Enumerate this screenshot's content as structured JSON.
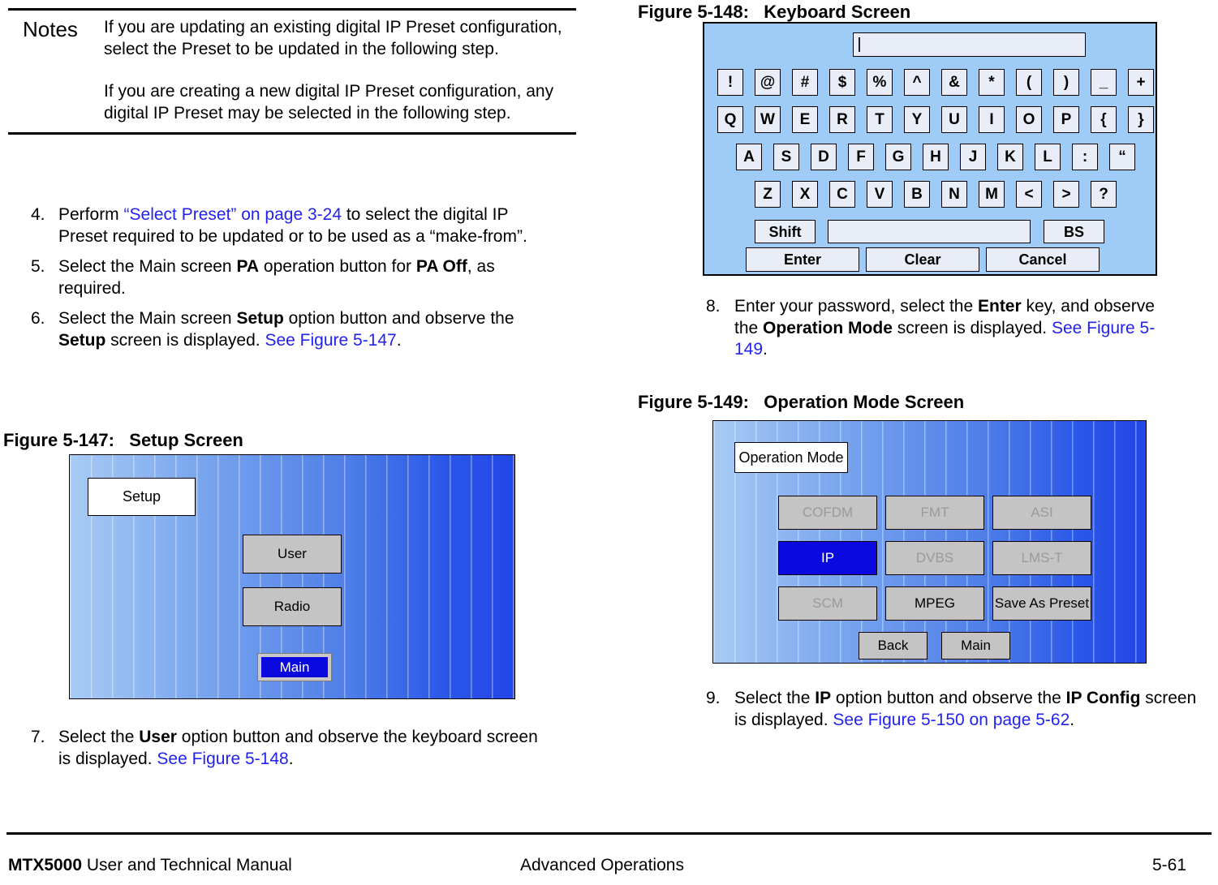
{
  "notes": {
    "label": "Notes",
    "paragraph1": "If you are updating an existing digital IP Preset configuration, select the Preset to be updated in the following step.",
    "paragraph2": "If you are creating a new digital IP Preset configuration, any digital IP Preset may be selected in the following step."
  },
  "steps": {
    "s4": {
      "num": "4.",
      "t1": "Perform ",
      "link1": "“Select Preset” on page 3-24",
      "t2": " to select the digital IP Preset required to be updated or to be used as a “make-from”."
    },
    "s5": {
      "num": "5.",
      "t1": "Select the Main screen ",
      "b1": "PA",
      "t2": " operation button for ",
      "b2": "PA Off",
      "t3": ", as required."
    },
    "s6": {
      "num": "6.",
      "t1": "Select the Main screen ",
      "b1": "Setup",
      "t2": " option button and observe the ",
      "b2": "Setup",
      "t3": " screen is displayed.  ",
      "link1": "See Figure 5-147",
      "t4": "."
    },
    "s7": {
      "num": "7.",
      "t1": "Select the ",
      "b1": "User",
      "t2": " option button and observe the keyboard screen is displayed.  ",
      "link1": "See Figure 5-148",
      "t3": "."
    },
    "s8": {
      "num": "8.",
      "t1": "Enter your password, select the ",
      "b1": "Enter",
      "t2": " key, and observe the ",
      "b2": "Operation Mode",
      "t3": " screen is displayed. ",
      "link1": "See Figure 5-149",
      "t4": "."
    },
    "s9": {
      "num": "9.",
      "t1": "Select the ",
      "b1": "IP",
      "t2": " option button and observe the ",
      "b2": "IP Config",
      "t3": " screen is displayed.  ",
      "link1": "See Figure 5-150 on page 5-62",
      "t4": "."
    }
  },
  "figure_147": {
    "caption": "Figure 5-147:   Setup Screen",
    "title_button": "Setup",
    "buttons": [
      {
        "label": "User",
        "state": "normal"
      },
      {
        "label": "Radio",
        "state": "normal"
      },
      {
        "label": "Main",
        "state": "selected"
      }
    ]
  },
  "figure_148": {
    "caption": "Figure 5-148:   Keyboard Screen",
    "input_value": "",
    "rows": [
      [
        "!",
        "@",
        "#",
        "$",
        "%",
        "^",
        "&",
        "*",
        "(",
        ")",
        "_",
        "+"
      ],
      [
        "Q",
        "W",
        "E",
        "R",
        "T",
        "Y",
        "U",
        "I",
        "O",
        "P",
        "{",
        "}"
      ],
      [
        "A",
        "S",
        "D",
        "F",
        "G",
        "H",
        "J",
        "K",
        "L",
        ":",
        "“"
      ],
      [
        "Z",
        "X",
        "C",
        "V",
        "B",
        "N",
        "M",
        "<",
        ">",
        "?"
      ]
    ],
    "shift_label": "Shift",
    "space_label": "",
    "bs_label": "BS",
    "enter_label": "Enter",
    "clear_label": "Clear",
    "cancel_label": "Cancel"
  },
  "figure_149": {
    "caption": "Figure 5-149:   Operation Mode Screen",
    "title_button": "Operation Mode",
    "grid": [
      {
        "label": "COFDM",
        "state": "disabled"
      },
      {
        "label": "FMT",
        "state": "disabled"
      },
      {
        "label": "ASI",
        "state": "disabled"
      },
      {
        "label": "IP",
        "state": "selected"
      },
      {
        "label": "DVBS",
        "state": "disabled"
      },
      {
        "label": "LMS-T",
        "state": "disabled"
      },
      {
        "label": "SCM",
        "state": "disabled"
      },
      {
        "label": "MPEG",
        "state": "normal"
      },
      {
        "label": "Save As Preset",
        "state": "normal"
      }
    ],
    "nav": [
      {
        "label": "Back",
        "state": "normal"
      },
      {
        "label": "Main",
        "state": "normal"
      }
    ]
  },
  "footer": {
    "manual_bold": "MTX5000",
    "manual_rest": " User and Technical Manual",
    "section": "Advanced Operations",
    "page": "5-61"
  },
  "colors": {
    "link": "#2222ee",
    "selected_button": "#0a0ae0",
    "button_face": "#c4c4c4",
    "keyboard_bg": "#9fcbf7",
    "key_face": "#e8edf7"
  }
}
